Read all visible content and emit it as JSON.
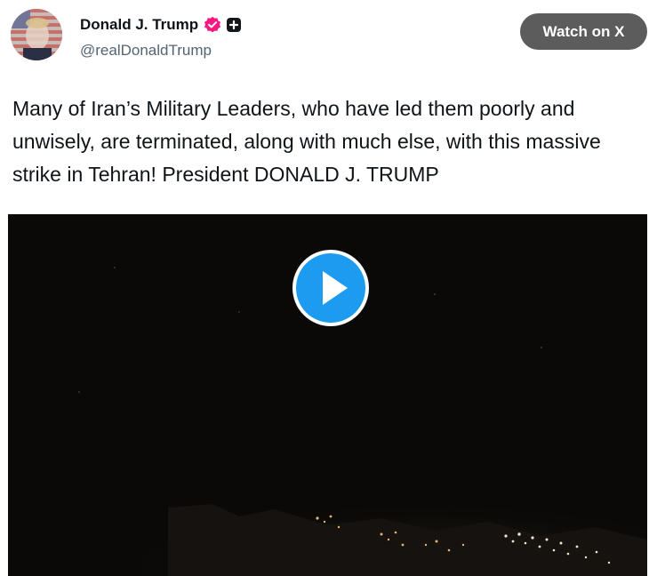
{
  "post": {
    "author_name": "Donald J. Trump",
    "handle": "@realDonaldTrump",
    "text": "Many of Iran’s Military Leaders, who have led them poorly and unwisely, are terminated, along with much else, with this massive strike in Tehran! President DONALD J. TRUMP"
  },
  "header": {
    "watch_button_label": "Watch on X"
  },
  "icons": {
    "verified": "verified-badge-icon",
    "affiliation": "plus-affiliation-icon",
    "play": "play-icon"
  },
  "colors": {
    "verified_badge": "#f91880",
    "play_button": "#1d9bf0",
    "watch_button": "#5c5c5c",
    "handle_text": "#536471"
  }
}
